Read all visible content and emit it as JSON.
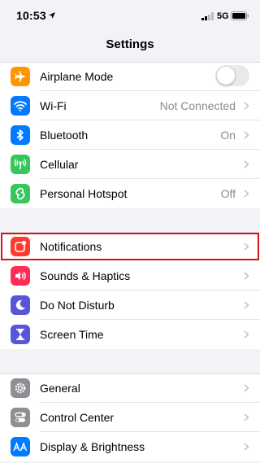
{
  "status_bar": {
    "time": "10:53",
    "network": "5G"
  },
  "nav": {
    "title": "Settings"
  },
  "groups": [
    {
      "items": [
        {
          "label": "Airplane Mode",
          "value": "",
          "icon": "airplane-icon",
          "color": "#ff9500",
          "control": "toggle-off"
        },
        {
          "label": "Wi-Fi",
          "value": "Not Connected",
          "icon": "wifi-icon",
          "color": "#007aff"
        },
        {
          "label": "Bluetooth",
          "value": "On",
          "icon": "bluetooth-icon",
          "color": "#007aff"
        },
        {
          "label": "Cellular",
          "value": "",
          "icon": "cellular-antenna-icon",
          "color": "#34c759"
        },
        {
          "label": "Personal Hotspot",
          "value": "Off",
          "icon": "hotspot-link-icon",
          "color": "#34c759"
        }
      ]
    },
    {
      "items": [
        {
          "label": "Notifications",
          "value": "",
          "icon": "notifications-icon",
          "color": "#ff3b30",
          "highlighted": true
        },
        {
          "label": "Sounds & Haptics",
          "value": "",
          "icon": "speaker-icon",
          "color": "#ff2d55"
        },
        {
          "label": "Do Not Disturb",
          "value": "",
          "icon": "moon-icon",
          "color": "#5856d6"
        },
        {
          "label": "Screen Time",
          "value": "",
          "icon": "hourglass-icon",
          "color": "#5856d6"
        }
      ]
    },
    {
      "items": [
        {
          "label": "General",
          "value": "",
          "icon": "gear-icon",
          "color": "#8e8e93"
        },
        {
          "label": "Control Center",
          "value": "",
          "icon": "toggles-icon",
          "color": "#8e8e93"
        },
        {
          "label": "Display & Brightness",
          "value": "",
          "icon": "text-size-icon",
          "color": "#007aff"
        }
      ]
    }
  ],
  "colors": {
    "highlight": "#d6121d",
    "background": "#f2f2f7",
    "chevron": "#c4c4c7"
  }
}
